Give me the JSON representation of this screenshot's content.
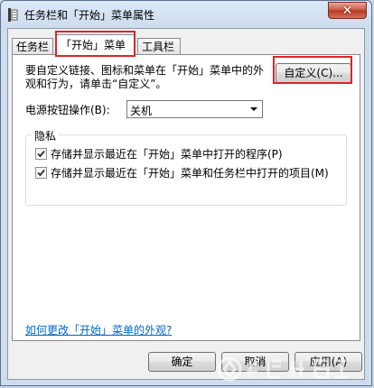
{
  "window": {
    "title": "任务栏和「开始」菜单属性",
    "close_glyph": "✕"
  },
  "tabs": [
    {
      "label": "任务栏"
    },
    {
      "label": "「开始」菜单"
    },
    {
      "label": "工具栏"
    }
  ],
  "start_menu": {
    "description": "要自定义链接、图标和菜单在「开始」菜单中的外观和行为，请单击“自定义”。",
    "customize_button": "自定义(C)...",
    "power_label": "电源按钮操作(B):",
    "power_value": "关机",
    "privacy": {
      "label": "隐私",
      "options": [
        {
          "label": "存储并显示最近在「开始」菜单中打开的程序(P)",
          "checked": true
        },
        {
          "label": "存储并显示最近在「开始」菜单和任务栏中打开的项目(M)",
          "checked": true
        }
      ]
    },
    "help_link": "如何更改「开始」菜单的外观?"
  },
  "footer": {
    "ok": "确定",
    "cancel": "取消",
    "apply": "应用(A)"
  },
  "highlight_color": "#e0222a"
}
